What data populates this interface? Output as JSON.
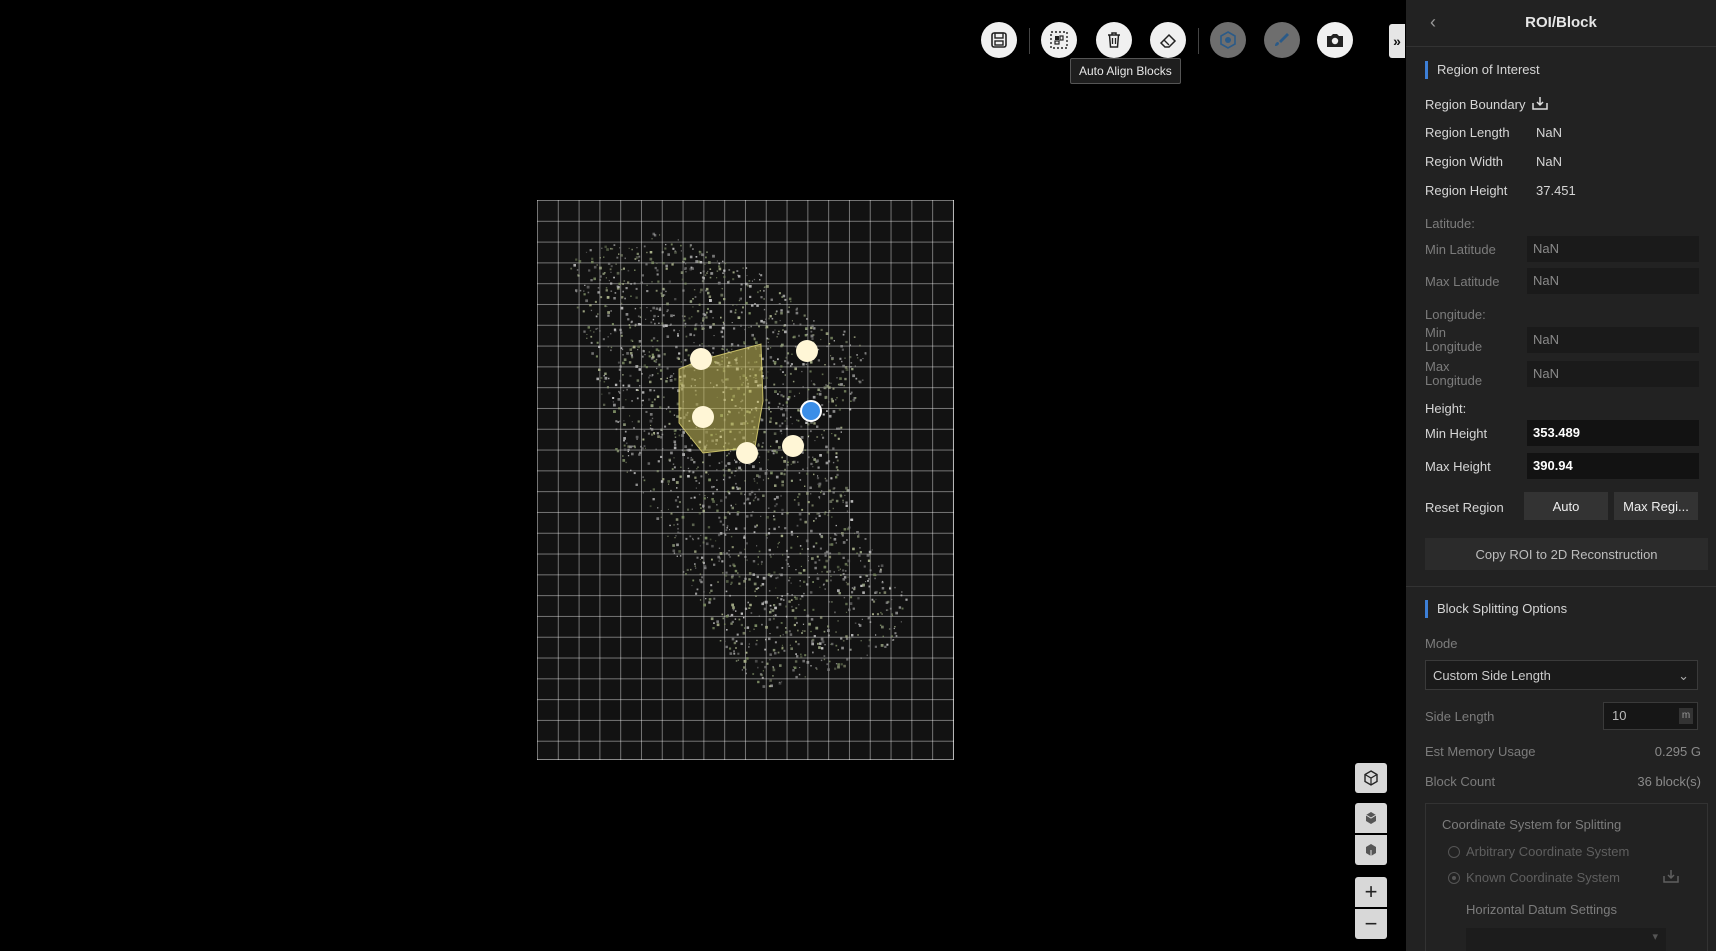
{
  "toolbar": {
    "buttons": [
      {
        "name": "save-icon"
      },
      {
        "name": "auto-align-blocks-icon"
      },
      {
        "name": "trash-icon"
      },
      {
        "name": "eraser-icon"
      },
      {
        "name": "region-icon"
      },
      {
        "name": "brush-icon"
      },
      {
        "name": "camera-icon"
      }
    ],
    "tooltip": "Auto Align Blocks",
    "collapse_label": "»"
  },
  "view_controls": {
    "zoom_in": "+",
    "zoom_out": "−"
  },
  "panel": {
    "title": "ROI/Block",
    "back_icon": "‹",
    "roi": {
      "section_title": "Region of Interest",
      "boundary_label": "Region Boundary",
      "length_label": "Region Length",
      "length_value": "NaN",
      "width_label": "Region Width",
      "width_value": "NaN",
      "height_label": "Region Height",
      "height_value": "37.451",
      "latitude_label": "Latitude:",
      "min_lat_label": "Min Latitude",
      "min_lat_value": "NaN",
      "max_lat_label": "Max Latitude",
      "max_lat_value": "NaN",
      "longitude_label": "Longitude:",
      "min_lon_label_1": "Min",
      "min_lon_label_2": "Longitude",
      "min_lon_value": "NaN",
      "max_lon_label_1": "Max",
      "max_lon_label_2": "Longitude",
      "max_lon_value": "NaN",
      "height_section_label": "Height:",
      "min_height_label": "Min Height",
      "min_height_value": "353.489",
      "max_height_label": "Max Height",
      "max_height_value": "390.94",
      "reset_label": "Reset Region",
      "auto_button": "Auto",
      "max_region_button": "Max Regi...",
      "copy_button": "Copy ROI to 2D Reconstruction"
    },
    "block": {
      "section_title": "Block Splitting Options",
      "mode_label": "Mode",
      "mode_value": "Custom Side Length",
      "side_length_label": "Side Length",
      "side_length_value": "10",
      "side_length_unit": "m",
      "memory_label": "Est Memory Usage",
      "memory_value": "0.295 G",
      "block_count_label": "Block Count",
      "block_count_value": "36 block(s)",
      "coord_title": "Coordinate System for Splitting",
      "coord_option_1": "Arbitrary Coordinate System",
      "coord_option_2": "Known Coordinate System",
      "horizontal_datum": "Horizontal Datum Settings"
    }
  }
}
